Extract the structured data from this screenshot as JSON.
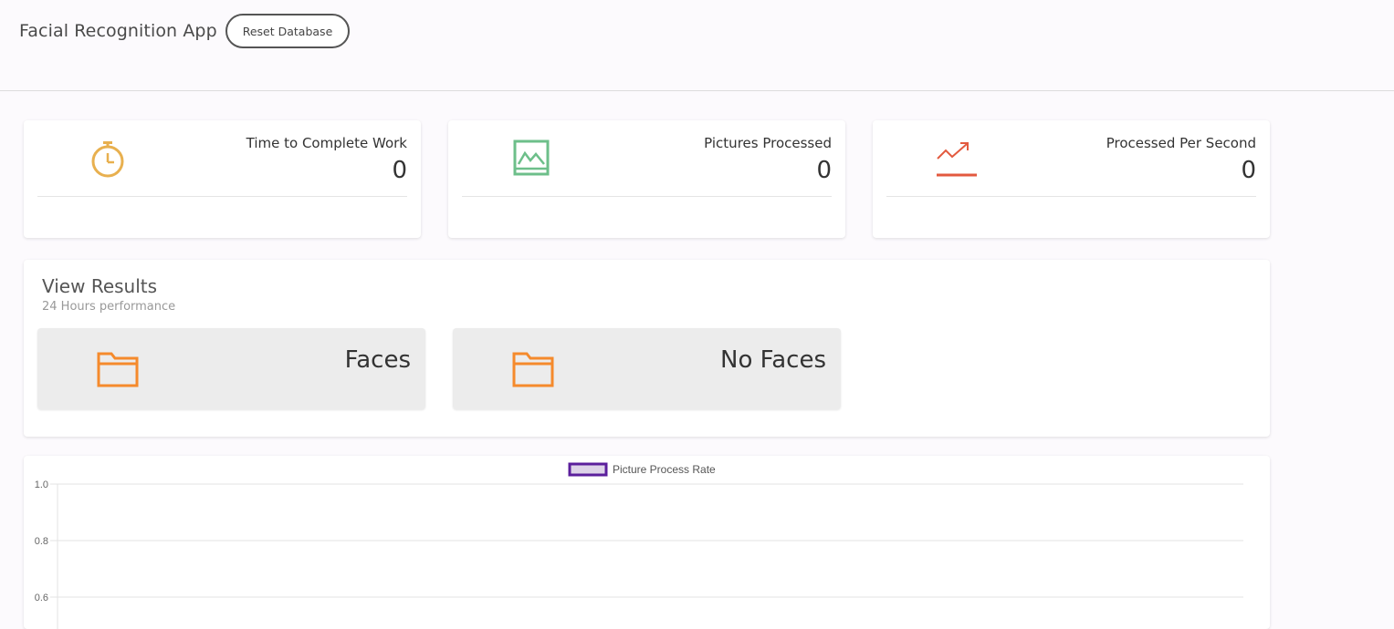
{
  "header": {
    "app_title": "Facial Recognition App",
    "reset_label": "Reset Database"
  },
  "stats": [
    {
      "label": "Time to Complete Work",
      "value": "0",
      "icon": "stopwatch-icon",
      "color": "#e8b04f"
    },
    {
      "label": "Pictures Processed",
      "value": "0",
      "icon": "picture-icon",
      "color": "#6dbf8a"
    },
    {
      "label": "Processed Per Second",
      "value": "0",
      "icon": "trending-up-icon",
      "color": "#e35a3f"
    }
  ],
  "results": {
    "title": "View Results",
    "subtitle": "24 Hours performance",
    "folders": [
      {
        "label": "Faces",
        "icon": "folder-icon",
        "color": "#f58a2c"
      },
      {
        "label": "No Faces",
        "icon": "folder-icon",
        "color": "#f58a2c"
      }
    ]
  },
  "chart_data": {
    "type": "line",
    "series": [
      {
        "name": "Picture Process Rate",
        "values": []
      }
    ],
    "legend_color": "#5b1f9c",
    "yticks": [
      "1.0",
      "0.8",
      "0.6"
    ],
    "ylim": [
      0.6,
      1.0
    ],
    "grid": true,
    "legend": "top-center"
  }
}
